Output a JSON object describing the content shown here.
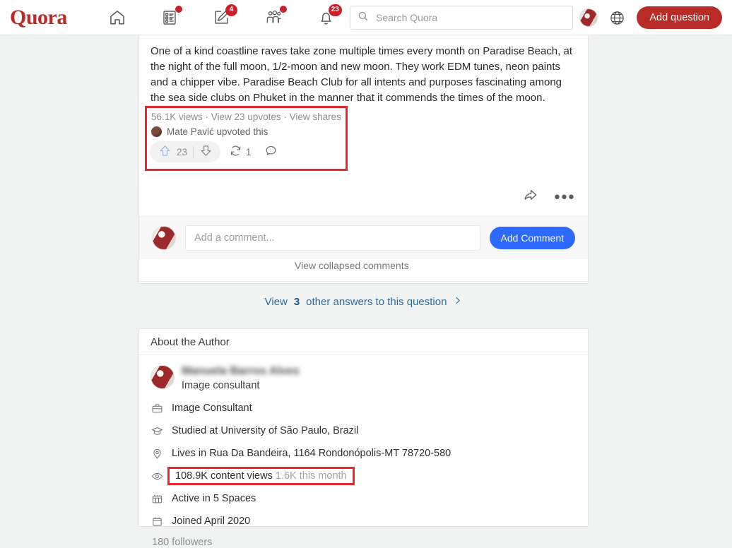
{
  "header": {
    "logo": "Quora",
    "nav": [
      {
        "name": "home-icon",
        "badge": null
      },
      {
        "name": "answers-icon",
        "badge": "dot"
      },
      {
        "name": "write-icon",
        "badge": "4"
      },
      {
        "name": "spaces-icon",
        "badge": "dot"
      },
      {
        "name": "notifications-icon",
        "badge": "23"
      }
    ],
    "search": {
      "placeholder": "Search Quora",
      "value": ""
    },
    "language_icon": "globe-icon",
    "add_question_label": "Add question"
  },
  "answer": {
    "text": "One of a kind coastline raves take zone multiple times every month on Paradise Beach, at the night of the full moon, 1/2-moon and new moon. They work EDM tunes, neon paints and a chipper vibe. Paradise Beach Club for all intents and purposes fascinating among the sea side clubs on Phuket in the manner that it commends the times of the moon.",
    "stats_line": "56.1K views · View 23 upvotes · View shares",
    "upvoter_text": "Mate Pavić upvoted this",
    "upvote_count": "23",
    "repost_count": "1",
    "highlight_color": "#e8272c"
  },
  "comments": {
    "placeholder": "Add a comment...",
    "value": "",
    "button_label": "Add Comment",
    "collapsed_label": "View collapsed comments"
  },
  "other_answers": {
    "prefix": "View",
    "count": "3",
    "suffix": "other answers to this question"
  },
  "author": {
    "section_title": "About the Author",
    "name": "Manuela Barros Alves",
    "tagline": "Image consultant",
    "details": [
      {
        "icon": "briefcase-icon",
        "text": "Image Consultant"
      },
      {
        "icon": "graduation-cap-icon",
        "text": "Studied at University of São Paulo, Brazil"
      },
      {
        "icon": "location-pin-icon",
        "text": "Lives in Rua Da Bandeira, 1164 Rondonópolis-MT 78720-580"
      }
    ],
    "views": {
      "icon": "eye-icon",
      "primary": "108.9K content views",
      "secondary": "1.6K this month"
    },
    "details2": [
      {
        "icon": "spaces-grid-icon",
        "text": "Active in 5 Spaces"
      },
      {
        "icon": "calendar-icon",
        "text": "Joined April 2020"
      }
    ],
    "followers": "180 followers"
  }
}
